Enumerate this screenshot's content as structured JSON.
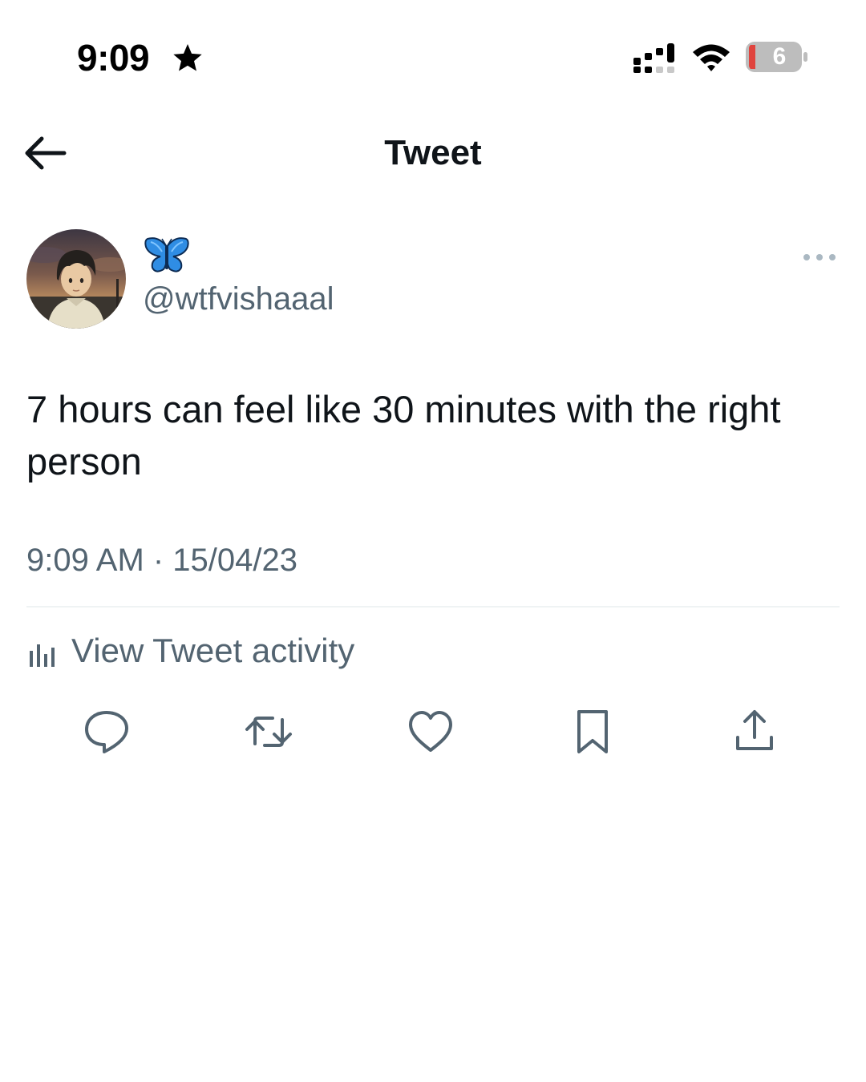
{
  "status_bar": {
    "time": "9:09",
    "time_icon": "star-icon",
    "battery_level": "6",
    "battery_color": "#e0443e"
  },
  "nav": {
    "back_icon": "arrow-left-icon",
    "title": "Tweet"
  },
  "author": {
    "display_name_icon": "butterfly-emoji",
    "handle": "@wtfvishaaal",
    "more_icon": "more-horizontal-icon"
  },
  "tweet": {
    "text": "7 hours can feel like 30 minutes with the right person",
    "timestamp": "9:09 AM · 15/04/23"
  },
  "activity": {
    "icon": "analytics-icon",
    "label": "View Tweet activity"
  },
  "actions": [
    {
      "icon": "reply-icon"
    },
    {
      "icon": "retweet-icon"
    },
    {
      "icon": "like-icon"
    },
    {
      "icon": "bookmark-icon"
    },
    {
      "icon": "share-icon"
    }
  ],
  "colors": {
    "primary_text": "#0f1419",
    "secondary_text": "#536471",
    "divider": "#eff3f4",
    "butterfly": "#1d9bf0"
  }
}
